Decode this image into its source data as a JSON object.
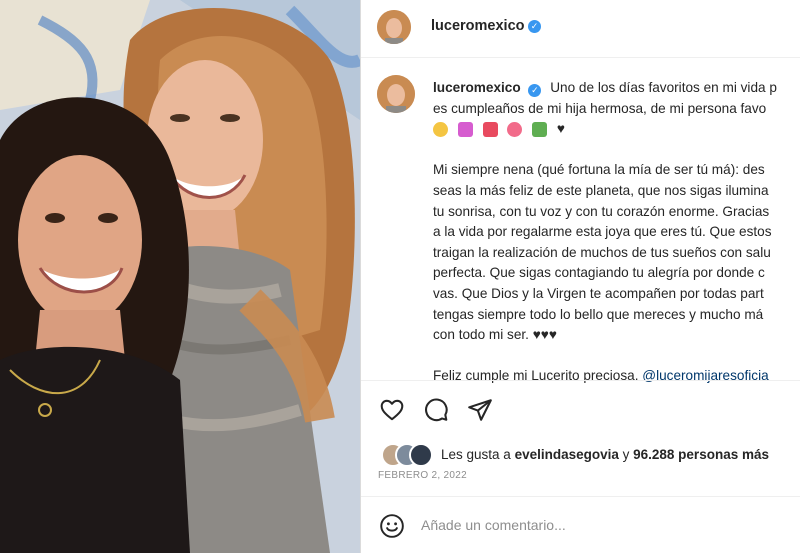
{
  "post": {
    "username": "luceromexico",
    "photo_alt": "Lucero y su hija Lucerito",
    "caption_lines": [
      "Uno de los días favoritos en mi vida p",
      "es cumpleaños de mi hija hermosa, de mi persona favo"
    ],
    "emojis": [
      "sparkle",
      "party-popper",
      "gift",
      "heart-with-ribbon",
      "flower-bouquet",
      "black-heart"
    ],
    "emoji_tail": "♥",
    "body_lines": [
      "Mi siempre nena (qué fortuna la mía de ser tú má): des",
      "seas la más feliz de este planeta, que nos sigas ilumina",
      "tu sonrisa, con tu voz y con tu corazón enorme. Gracias",
      "a la vida por regalarme esta joya que eres tú. Que estos",
      "traigan la realización de muchos de tus sueños con salu",
      "perfecta. Que sigas contagiando tu alegría por donde c",
      "vas. Que Dios y la Virgen te acompañen por todas part",
      "tengas siempre todo lo bello que mereces y mucho má",
      "con todo mi ser. ♥♥♥"
    ],
    "closing_text": "Feliz cumple mi Lucerito preciosa. ",
    "closing_mention": "@luceromijaresoficia"
  },
  "likes": {
    "prefix": "Les gusta a ",
    "user": "evelindasegovia",
    "middle": " y ",
    "count": "96.288 personas más"
  },
  "date": "FEBRERO 2, 2022",
  "comment": {
    "placeholder": "Añade un comentario..."
  },
  "colors": {
    "verified": "#3897f0",
    "mention": "#00376b",
    "secondary": "#8e8e8e"
  }
}
